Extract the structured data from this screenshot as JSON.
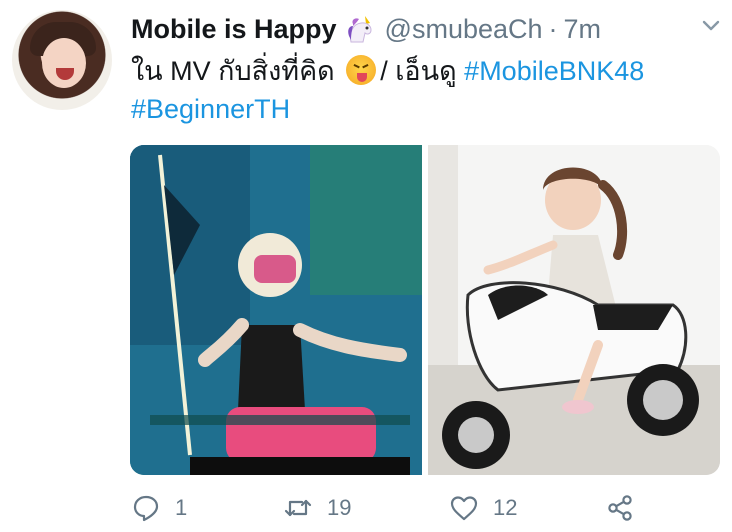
{
  "tweet": {
    "author_name": "Mobile is Happy",
    "handle": "@smubeaCh",
    "separator": "·",
    "time": "7m",
    "text_line1_pre": "ใน MV กับสิ่งที่คิด",
    "text_line1_post": "/ เอ็นดู",
    "hashtag1": "#MobileBNK48",
    "hashtag2": "#BeginnerTH",
    "emoji": "squinting-face-with-tongue-icon",
    "accent_color": "#1b95e0",
    "secondary_color": "#657786"
  },
  "actions": {
    "reply_count": "1",
    "retweet_count": "19",
    "like_count": "12"
  },
  "media": {
    "left_image": "performer-on-motorbike-photo",
    "right_image": "child-on-toy-motorbike-photo"
  }
}
